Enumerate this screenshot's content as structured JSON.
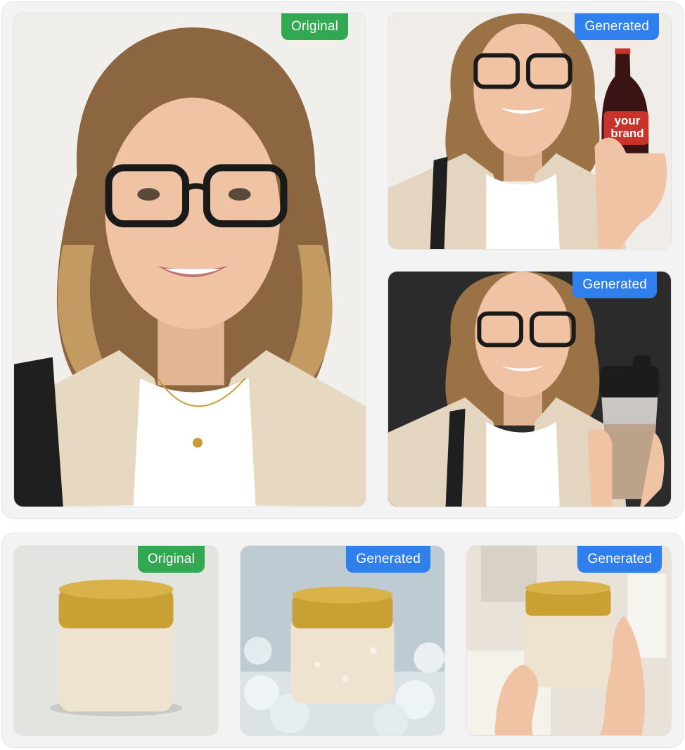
{
  "labels": {
    "original": "Original",
    "generated": "Generated"
  },
  "product_text": "your brand",
  "colors": {
    "original_badge": "#33a852",
    "generated_badge": "#2f80ed",
    "panel_background": "#f3f3f3"
  },
  "images": {
    "portrait_original": "woman with glasses, wavy hair, beige blazer",
    "portrait_soda": "woman holding a soda bottle",
    "portrait_shaker": "woman holding a protein shaker, dark background",
    "jar_original": "cream jar with gold lid, plain background",
    "jar_ice": "cream jar with gold lid on crushed ice",
    "jar_hands": "cream jar with gold lid held in hands"
  }
}
